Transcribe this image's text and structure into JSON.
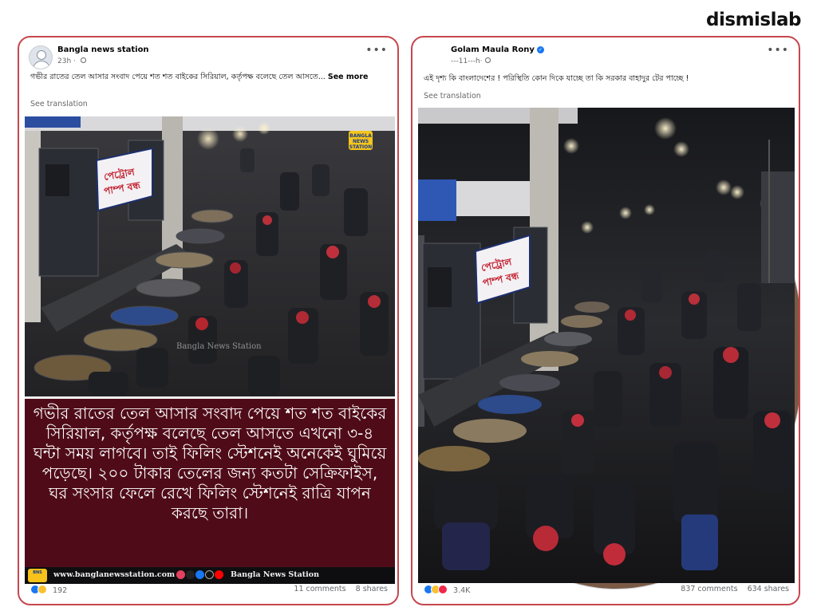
{
  "brand": {
    "logo_text": "dismislab"
  },
  "posts": [
    {
      "page_name": "Bangla news station",
      "time": "23h",
      "caption": "গভীর রাতের তেল আসার সংবাদ পেয়ে শত শত বাইকের সিরিয়াল, কর্তৃপক্ষ বলেছে তেল আসতে...",
      "see_more": "See more",
      "see_translation": "See translation",
      "image_banner_text": "গভীর রাতের তেল আসার সংবাদ পেয়ে শত শত বাইকের সিরিয়াল, কর্তৃপক্ষ বলেছে তেল আসতে এখনো ৩-৪ ঘন্টা সময় লাগবে। তাই ফিলিং স্টেশনেই অনেকেই ঘুমিয়ে পড়েছে। ২০০ টাকার তেলের জন্য কতটা সেক্রিফাইস, ঘর সংসার ফেলে রেখে ফিলিং স্টেশনেই রাত্রি যাপন করছে তারা।",
      "image_url_text": "www.banglanewsstation.com",
      "image_page_name": "Bangla News Station",
      "image_watermark": "Bangla News Station",
      "image_logo": "BANGLA NEWS STATION",
      "reactions_count": "192",
      "comments": "11 comments",
      "shares": "8 shares"
    },
    {
      "page_name": "Golam Maula Rony",
      "time": "---11---h·",
      "caption": "এই দৃশ্য কি বাংলাদেশের ! পরিস্থিতি কোন দিকে যাচ্ছে তা কি সরকার বাহাদুর টের পাচ্ছে !",
      "see_translation": "See translation",
      "reactions_count": "3.4K",
      "comments": "837 comments",
      "shares": "634 shares"
    }
  ],
  "colors": {
    "card_border": "#c6474d",
    "banner_bg": "#4f0c18",
    "facebook_blue": "#1877f2"
  }
}
